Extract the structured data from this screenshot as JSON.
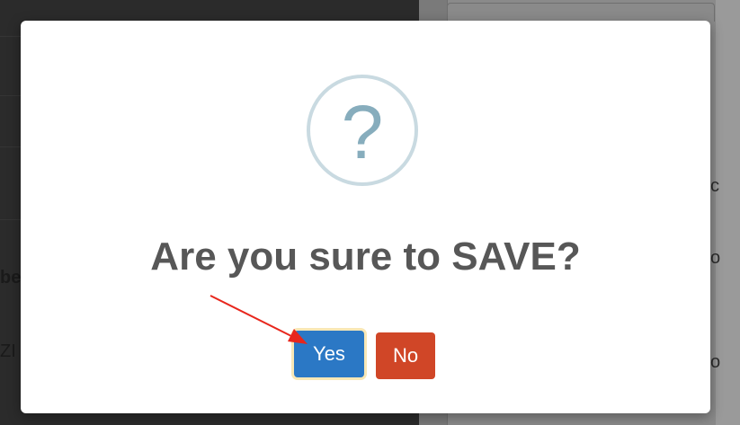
{
  "background": {
    "left_text_fragments": [
      "be",
      "ZI"
    ],
    "right_glyphs": [
      "c",
      "o",
      "o"
    ]
  },
  "dialog": {
    "icon": "question-mark-icon",
    "icon_glyph": "?",
    "title": "Are you sure to SAVE?",
    "confirm_label": "Yes",
    "cancel_label": "No"
  },
  "colors": {
    "confirm": "#2b78c5",
    "cancel": "#d04627",
    "icon_ring": "#c9dae1",
    "icon_glyph": "#87adbd",
    "title": "#575757",
    "annotation_arrow": "#e8261c"
  },
  "annotation": {
    "type": "arrow",
    "points_to": "confirm-button"
  }
}
